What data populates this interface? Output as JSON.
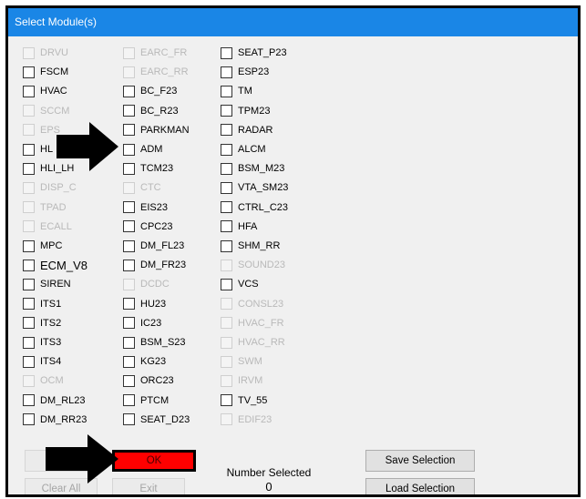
{
  "window": {
    "title": "Select Module(s)"
  },
  "columns": [
    [
      {
        "label": "DRVU",
        "enabled": false
      },
      {
        "label": "FSCM",
        "enabled": true
      },
      {
        "label": "HVAC",
        "enabled": true
      },
      {
        "label": "SCCM",
        "enabled": false
      },
      {
        "label": "EPS",
        "enabled": false
      },
      {
        "label": "HL",
        "enabled": true
      },
      {
        "label": "HLI_LH",
        "enabled": true
      },
      {
        "label": "DISP_C",
        "enabled": false
      },
      {
        "label": "TPAD",
        "enabled": false
      },
      {
        "label": "ECALL",
        "enabled": false
      },
      {
        "label": "MPC",
        "enabled": true
      },
      {
        "label": "ECM_V8",
        "enabled": true,
        "big": true
      },
      {
        "label": "SIREN",
        "enabled": true
      },
      {
        "label": "ITS1",
        "enabled": true
      },
      {
        "label": "ITS2",
        "enabled": true
      },
      {
        "label": "ITS3",
        "enabled": true
      },
      {
        "label": "ITS4",
        "enabled": true
      },
      {
        "label": "OCM",
        "enabled": false
      },
      {
        "label": "DM_RL23",
        "enabled": true
      },
      {
        "label": "DM_RR23",
        "enabled": true
      }
    ],
    [
      {
        "label": "EARC_FR",
        "enabled": false
      },
      {
        "label": "EARC_RR",
        "enabled": false
      },
      {
        "label": "BC_F23",
        "enabled": true
      },
      {
        "label": "BC_R23",
        "enabled": true
      },
      {
        "label": "PARKMAN",
        "enabled": true
      },
      {
        "label": "ADM",
        "enabled": true
      },
      {
        "label": "TCM23",
        "enabled": true
      },
      {
        "label": "CTC",
        "enabled": false
      },
      {
        "label": "EIS23",
        "enabled": true
      },
      {
        "label": "CPC23",
        "enabled": true
      },
      {
        "label": "DM_FL23",
        "enabled": true
      },
      {
        "label": "DM_FR23",
        "enabled": true
      },
      {
        "label": "DCDC",
        "enabled": false
      },
      {
        "label": "HU23",
        "enabled": true
      },
      {
        "label": "IC23",
        "enabled": true
      },
      {
        "label": "BSM_S23",
        "enabled": true
      },
      {
        "label": "KG23",
        "enabled": true
      },
      {
        "label": "ORC23",
        "enabled": true
      },
      {
        "label": "PTCM",
        "enabled": true
      },
      {
        "label": "SEAT_D23",
        "enabled": true
      }
    ],
    [
      {
        "label": "SEAT_P23",
        "enabled": true
      },
      {
        "label": "ESP23",
        "enabled": true
      },
      {
        "label": "TM",
        "enabled": true
      },
      {
        "label": "TPM23",
        "enabled": true
      },
      {
        "label": "RADAR",
        "enabled": true
      },
      {
        "label": "ALCM",
        "enabled": true
      },
      {
        "label": "BSM_M23",
        "enabled": true
      },
      {
        "label": "VTA_SM23",
        "enabled": true
      },
      {
        "label": "CTRL_C23",
        "enabled": true
      },
      {
        "label": "HFA",
        "enabled": true
      },
      {
        "label": "SHM_RR",
        "enabled": true
      },
      {
        "label": "SOUND23",
        "enabled": false
      },
      {
        "label": "VCS",
        "enabled": true
      },
      {
        "label": "CONSL23",
        "enabled": false
      },
      {
        "label": "HVAC_FR",
        "enabled": false
      },
      {
        "label": "HVAC_RR",
        "enabled": false
      },
      {
        "label": "SWM",
        "enabled": false
      },
      {
        "label": "IRVM",
        "enabled": false
      },
      {
        "label": "TV_55",
        "enabled": true
      },
      {
        "label": "EDIF23",
        "enabled": false
      }
    ]
  ],
  "buttons": {
    "select_all": "",
    "ok": "OK",
    "clear_all": "Clear All",
    "exit": "Exit",
    "save_selection": "Save Selection",
    "load_selection": "Load Selection"
  },
  "number_selected": {
    "label": "Number Selected",
    "value": "0"
  },
  "colors": {
    "titlebar": "#1a86e6",
    "ok_button": "#ff0000",
    "annotation_arrow": "#000000"
  }
}
